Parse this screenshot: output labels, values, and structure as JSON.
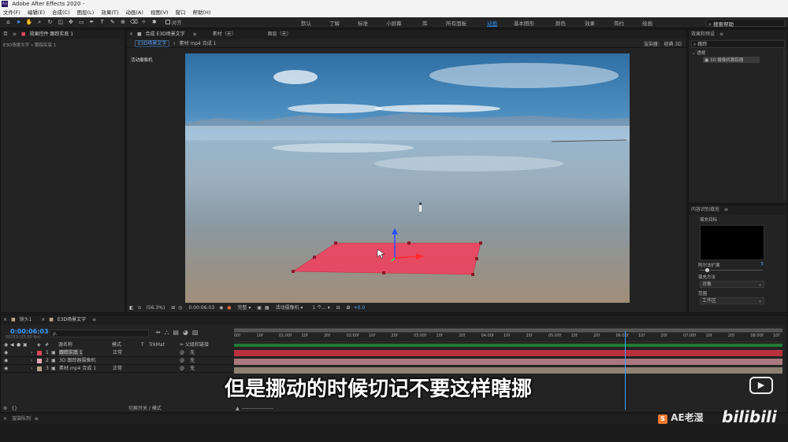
{
  "app": {
    "title": "Adobe After Effects 2020 -"
  },
  "menu": [
    "文件(F)",
    "编辑(E)",
    "合成(C)",
    "图层(L)",
    "效果(T)",
    "动画(A)",
    "视图(V)",
    "窗口",
    "帮助(H)"
  ],
  "toolbar": {
    "align_label": "对齐",
    "workspaces": [
      "默认",
      "了解",
      "标准",
      "小屏幕",
      "库",
      "所有面板",
      "动画",
      "基本图形",
      "颜色",
      "效果",
      "简约",
      "绘画"
    ],
    "active_workspace": "动画",
    "search_help": "搜索帮助"
  },
  "left_panel": {
    "tab": "目",
    "effect_tab": "效果控件 跟踪实底 1",
    "breadcrumb": "E3D场景文字 • 跟踪实底 1"
  },
  "composition": {
    "tab_label": "合成 E3D场景文字",
    "footage_tab": "素材（无）",
    "layer_tab": "图层（无）",
    "subtab_active": "E3D场景文字",
    "subtab_other": "素材 mp4 合成 1",
    "renderer_label": "渲染器：",
    "renderer_value": "经典 3D",
    "camera_label": "活动摄像机",
    "bottom": {
      "zoom": "(56.3%)",
      "timecode": "0:00:06:03",
      "resolution": "完整",
      "camera": "活动摄像机",
      "views": "1 个...",
      "exposure": "+0.0"
    }
  },
  "right_panel": {
    "effects_title": "效果和预设",
    "search_value": "跟踪",
    "tree_group": "透视",
    "tree_item": "3D 摄像机跟踪器",
    "content_fill_title": "内容识别填充",
    "fill_target_label": "填充目标",
    "alpha_expand_label": "阿尔法扩展",
    "alpha_expand_value": "5",
    "fill_method_label": "填充方法",
    "fill_method_value": "对象",
    "range_label": "范围",
    "range_value": "工作区"
  },
  "timeline": {
    "tab1": "镜头1",
    "tab2": "E3D场景文字",
    "timecode": "0:00:06:03",
    "fps": "00153 (25.00 fps)",
    "search_placeholder": "ρ.",
    "columns": {
      "num": "#",
      "name": "源名称",
      "mode": "模式",
      "t": "T",
      "trkmat": "TrkMat",
      "parent": "父级和链接"
    },
    "layers": [
      {
        "num": "1",
        "name": "跟踪实底 1",
        "mode": "正常",
        "parent": "无",
        "color": "#d8475e",
        "bar": "#b9313f"
      },
      {
        "num": "2",
        "name": "3D 跟踪器摄像机",
        "mode": "",
        "parent": "无",
        "color": "#e8a7b3",
        "bar": "#a9787e"
      },
      {
        "num": "3",
        "name": "素材.mp4 合成 1",
        "mode": "正常",
        "parent": "无",
        "color": "#b6a48a",
        "bar": "#8e8172"
      }
    ],
    "ruler_labels": [
      "00f",
      "10f",
      "01:00f",
      "10f",
      "20f",
      "02:00f",
      "10f",
      "20f",
      "03:00f",
      "10f",
      "20f",
      "04:00f",
      "10f",
      "20f",
      "05:00f",
      "10f",
      "20f",
      "06:00f",
      "10f",
      "20f",
      "07:00f",
      "10f",
      "20f",
      "08:00f",
      "10f"
    ],
    "playhead_fraction": 0.712,
    "footer": "切换开关 / 模式"
  },
  "render_queue": {
    "label": "渲染队列"
  },
  "subtitle": "但是挪动的时候切记不要这样瞎挪",
  "watermark": {
    "channel": "AE老湿",
    "site": "bilibili"
  },
  "colors": {
    "solid_plane": "#f2405e",
    "accent_blue": "#2d8ceb",
    "timecode_blue": "#3d9bff"
  }
}
